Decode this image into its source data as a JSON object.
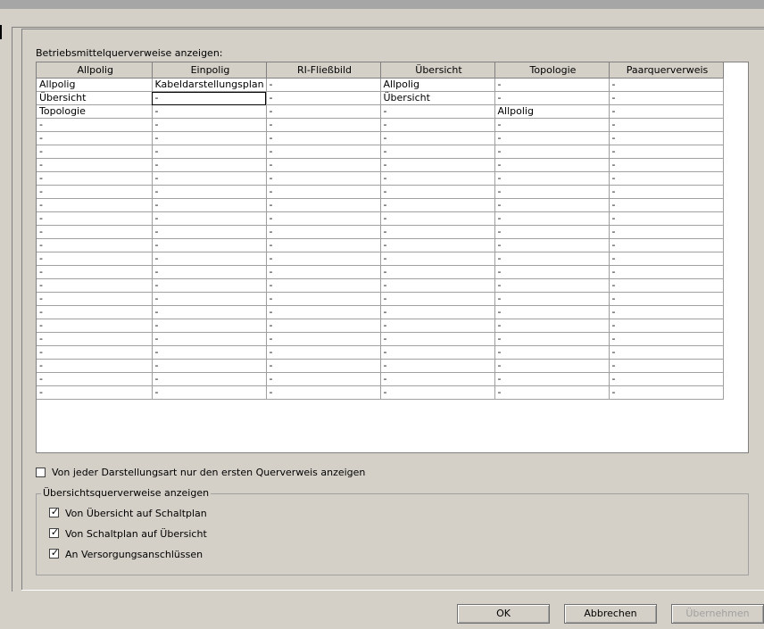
{
  "dialog": {
    "section_label": "Betriebsmittelquerverweise anzeigen:",
    "columns": [
      "Allpolig",
      "Einpolig",
      "RI-Fließbild",
      "Übersicht",
      "Topologie",
      "Paarquerverweis"
    ],
    "rows": [
      [
        "Allpolig",
        "Kabeldarstellungsplan",
        "-",
        "Allpolig",
        "-",
        "-"
      ],
      [
        "Übersicht",
        "-",
        "-",
        "Übersicht",
        "-",
        "-"
      ],
      [
        "Topologie",
        "-",
        "-",
        "-",
        "Allpolig",
        "-"
      ],
      [
        "-",
        "-",
        "-",
        "-",
        "-",
        "-"
      ],
      [
        "-",
        "-",
        "-",
        "-",
        "-",
        "-"
      ],
      [
        "-",
        "-",
        "-",
        "-",
        "-",
        "-"
      ],
      [
        "-",
        "-",
        "-",
        "-",
        "-",
        "-"
      ],
      [
        "-",
        "-",
        "-",
        "-",
        "-",
        "-"
      ],
      [
        "-",
        "-",
        "-",
        "-",
        "-",
        "-"
      ],
      [
        "-",
        "-",
        "-",
        "-",
        "-",
        "-"
      ],
      [
        "-",
        "-",
        "-",
        "-",
        "-",
        "-"
      ],
      [
        "-",
        "-",
        "-",
        "-",
        "-",
        "-"
      ],
      [
        "-",
        "-",
        "-",
        "-",
        "-",
        "-"
      ],
      [
        "-",
        "-",
        "-",
        "-",
        "-",
        "-"
      ],
      [
        "-",
        "-",
        "-",
        "-",
        "-",
        "-"
      ],
      [
        "-",
        "-",
        "-",
        "-",
        "-",
        "-"
      ],
      [
        "-",
        "-",
        "-",
        "-",
        "-",
        "-"
      ],
      [
        "-",
        "-",
        "-",
        "-",
        "-",
        "-"
      ],
      [
        "-",
        "-",
        "-",
        "-",
        "-",
        "-"
      ],
      [
        "-",
        "-",
        "-",
        "-",
        "-",
        "-"
      ],
      [
        "-",
        "-",
        "-",
        "-",
        "-",
        "-"
      ],
      [
        "-",
        "-",
        "-",
        "-",
        "-",
        "-"
      ],
      [
        "-",
        "-",
        "-",
        "-",
        "-",
        "-"
      ],
      [
        "-",
        "-",
        "-",
        "-",
        "-",
        "-"
      ]
    ],
    "selected_cell": "row 2, column Einpolig",
    "first_only_checkbox": {
      "label": "Von jeder Darstellungsart nur den ersten Querverweis anzeigen",
      "checked": false
    },
    "overview_group": {
      "title": "Übersichtsquerverweise anzeigen",
      "options": [
        {
          "label": "Von Übersicht auf Schaltplan",
          "checked": true
        },
        {
          "label": "Von Schaltplan auf Übersicht",
          "checked": true
        },
        {
          "label": "An Versorgungsanschlüssen",
          "checked": true
        }
      ]
    },
    "buttons": {
      "ok": "OK",
      "cancel": "Abbrechen",
      "apply": "Übernehmen"
    }
  }
}
